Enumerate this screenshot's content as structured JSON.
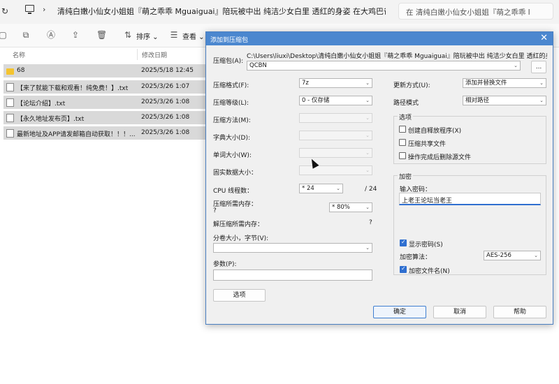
{
  "explorer": {
    "path": "清纯白嫩小仙女小姐姐『萌之乖乖 Mguaiguai』陪玩被中出 纯洁少女白里 透红的身姿 在大鸡巴爸爸的",
    "search_placeholder": "在 清纯白嫩小仙女小姐姐『萌之乖乖 I",
    "toolbar": {
      "sort_label": "排序",
      "view_label": "查看"
    },
    "columns": {
      "name": "名称",
      "modified": "修改日期"
    },
    "files": [
      {
        "name": "68",
        "date": "2025/5/18 12:45",
        "kind": "folder"
      },
      {
        "name": "【来了就能下载和观看！纯免费！】.txt",
        "date": "2025/3/26 1:07",
        "kind": "txt"
      },
      {
        "name": "【论坛介绍】.txt",
        "date": "2025/3/26 1:08",
        "kind": "txt"
      },
      {
        "name": "【永久地址发布页】.txt",
        "date": "2025/3/26 1:08",
        "kind": "txt"
      },
      {
        "name": "最新地址及APP请发邮箱自动获取！！！...",
        "date": "2025/3/26 1:08",
        "kind": "txt"
      }
    ]
  },
  "dialog": {
    "title": "添加到压缩包",
    "archive_label": "压缩包(A):",
    "archive_path": "C:\\Users\\liuxi\\Desktop\\清纯白嫩小仙女小姐姐『萌之乖乖 Mguaiguai』陪玩被中出 纯洁少女白里 透红的身姿 在",
    "archive_name": "QCBN",
    "browse_label": "...",
    "format_label": "压缩格式(F):",
    "format_value": "7z",
    "level_label": "压缩等级(L):",
    "level_value": "0 - 仅存储",
    "method_label": "压缩方法(M):",
    "dict_label": "字典大小(D):",
    "word_label": "单词大小(W):",
    "solid_label": "固实数据大小：",
    "cpu_label": "CPU 线程数：",
    "cpu_value": "* 24",
    "cpu_total": "/ 24",
    "mem_comp_label": "压缩所需内存：",
    "mem_comp_q": "?",
    "mem_comp_value": "* 80%",
    "mem_decomp_label": "解压缩所需内存：",
    "mem_decomp_q": "?",
    "split_label": "分卷大小，字节(V):",
    "params_label": "参数(P):",
    "options_button": "选项",
    "update_label": "更新方式(U):",
    "update_value": "添加并替换文件",
    "pathmode_label": "路径模式",
    "pathmode_value": "相对路径",
    "options_group": "选项",
    "opt_sfx": "创建自释放程序(X)",
    "opt_shared": "压缩共享文件",
    "opt_delete": "操作完成后删除源文件",
    "encrypt_group": "加密",
    "password_label": "输入密码：",
    "password_value": "上老王论坛当老王",
    "show_pw": "显示密码(S)",
    "enc_method_label": "加密算法：",
    "enc_method_value": "AES-256",
    "enc_names": "加密文件名(N)",
    "ok": "确定",
    "cancel": "取消",
    "help": "帮助"
  }
}
